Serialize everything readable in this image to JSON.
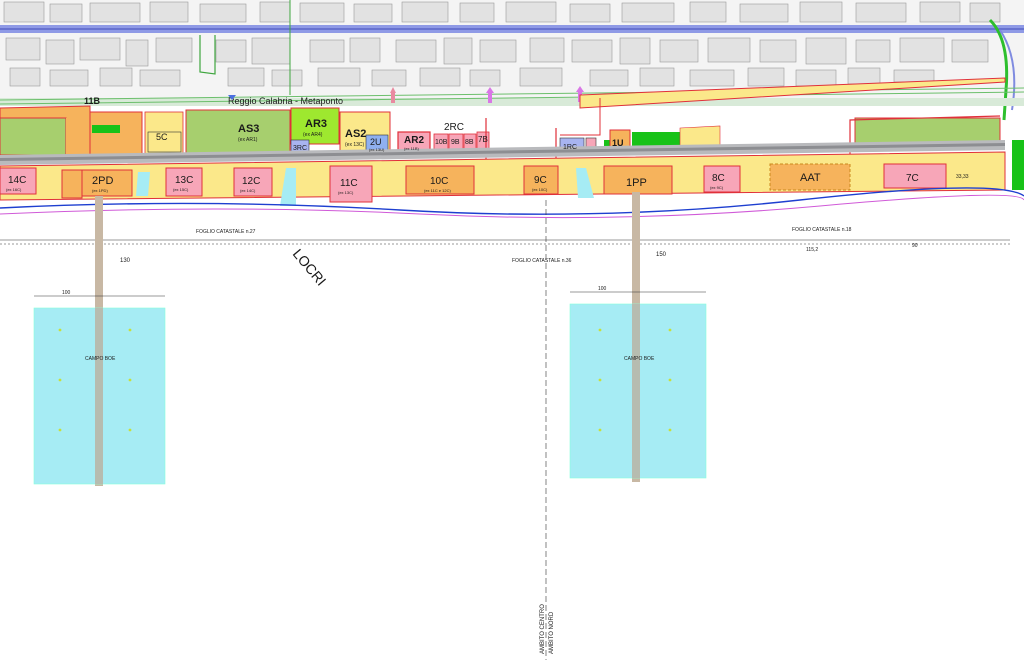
{
  "map": {
    "rail_line_label": "Reggio Calabria - Metaponto",
    "town_label": "LOCRI",
    "foglio_labels": [
      "FOGLIO CATASTALE n.27",
      "FOGLIO CATASTALE n.36",
      "FOGLIO CATASTALE n.18"
    ],
    "ambito_labels": [
      "AMBITO CENTRO",
      "AMBITO NORD"
    ],
    "campo_label": "CAMPO BOE",
    "dim_labels": [
      "130",
      "150",
      "100",
      "115,2",
      "90",
      "33,33"
    ],
    "zones_upper": [
      {
        "code": "11B",
        "sub": ""
      },
      {
        "code": "5C",
        "sub": ""
      },
      {
        "code": "AS3",
        "sub": "(ex AR1)"
      },
      {
        "code": "AR3",
        "sub": "(ex AR4)"
      },
      {
        "code": "AS2",
        "sub": "(ex 13C)"
      },
      {
        "code": "3RC",
        "sub": ""
      },
      {
        "code": "2U",
        "sub": "(ex 13U)"
      },
      {
        "code": "AR2",
        "sub": "(ex 11B)"
      },
      {
        "code": "2RC",
        "sub": ""
      },
      {
        "code": "10B",
        "sub": ""
      },
      {
        "code": "9B",
        "sub": ""
      },
      {
        "code": "8B",
        "sub": ""
      },
      {
        "code": "7B",
        "sub": ""
      },
      {
        "code": "1RC",
        "sub": ""
      },
      {
        "code": "1U",
        "sub": ""
      }
    ],
    "zones_lower": [
      {
        "code": "14C",
        "sub": "(ex 16C)"
      },
      {
        "code": "2PD",
        "sub": "(ex 1PD)"
      },
      {
        "code": "13C",
        "sub": "(ex 15C)"
      },
      {
        "code": "12C",
        "sub": "(ex 14C)"
      },
      {
        "code": "11C",
        "sub": "(ex 13C)"
      },
      {
        "code": "10C",
        "sub": "(ex 11C e 12C)"
      },
      {
        "code": "9C",
        "sub": "(ex 10C)"
      },
      {
        "code": "1PP",
        "sub": ""
      },
      {
        "code": "8C",
        "sub": "(ex 9C)"
      },
      {
        "code": "AAT",
        "sub": ""
      },
      {
        "code": "7C",
        "sub": ""
      }
    ],
    "colors": {
      "zone_yellow": "#fbe88a",
      "zone_orange": "#f6b35c",
      "zone_pink": "#f7a6b8",
      "park_green": "#a7cf6e",
      "bright_green": "#18c218",
      "sea_cyan": "#a6ecf4",
      "rail": "#cfd0d3",
      "boundary_red": "#e0303a",
      "road_blue": "#7f8be0"
    }
  }
}
